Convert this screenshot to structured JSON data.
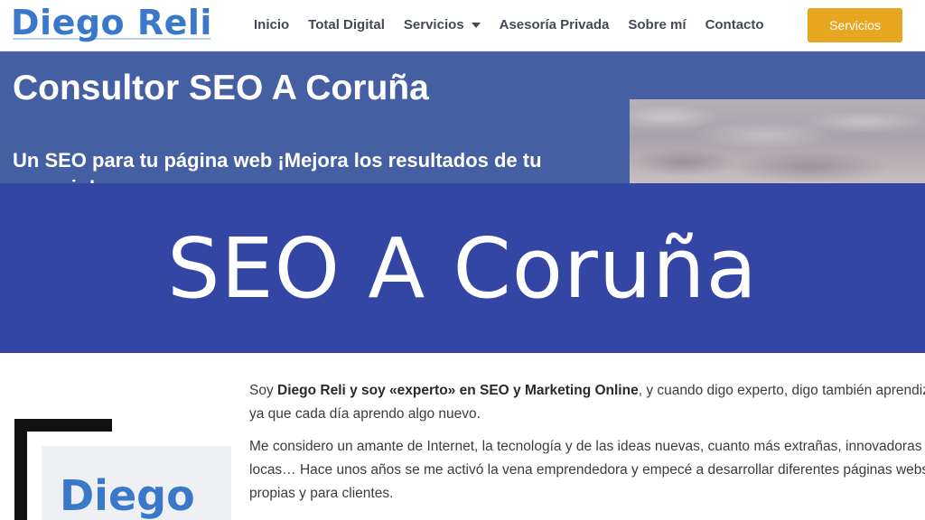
{
  "header": {
    "logo": "Diego Reli",
    "nav": {
      "inicio": "Inicio",
      "total_digital": "Total Digital",
      "servicios": "Servicios",
      "asesoria": "Asesoría Privada",
      "sobre_mi": "Sobre mí",
      "contacto": "Contacto"
    },
    "cta_label": "Servicios"
  },
  "hero": {
    "title": "Consultor SEO A Coruña",
    "subtitle": "Un SEO para tu página web ¡Mejora los resultados de tu negocio!"
  },
  "banner": {
    "text": "SEO A Coruña"
  },
  "content": {
    "p1": {
      "intro": "Soy ",
      "bold": "Diego Reli y soy «experto» en SEO y Marketing Online",
      "rest": ", y cuando digo experto, digo también aprendiz ya que cada día aprendo algo nuevo."
    },
    "p2": "Me considero un amante de Internet, la tecnología y de las ideas nuevas, cuanto más extrañas, innovadoras y locas…  Hace unos años se me activó la vena emprendedora y empecé a desarrollar diferentes páginas webs propias y para clientes.",
    "profile_text": "Diego"
  },
  "colors": {
    "brand_blue": "#3a78c9",
    "hero_bg": "#455fa3",
    "banner_bg": "#3446a4",
    "cta_bg": "#e8a720"
  }
}
